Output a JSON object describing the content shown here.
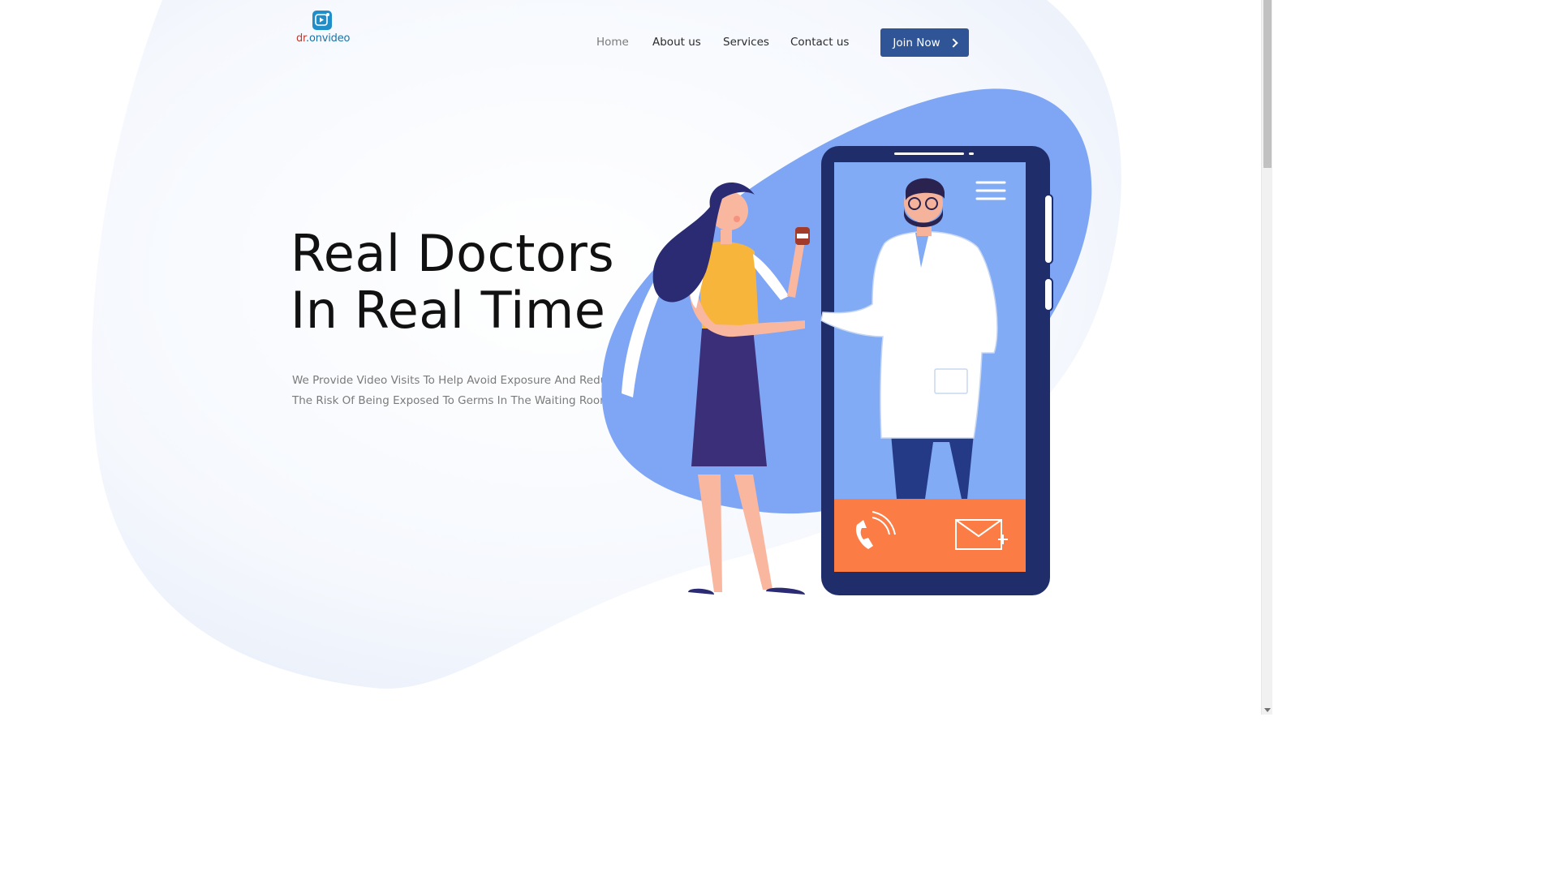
{
  "brand": {
    "logo_prefix": "dr",
    "logo_suffix": ".onvideo",
    "logo_icon": "play-video-icon"
  },
  "nav": {
    "items": [
      {
        "label": "Home",
        "active": true
      },
      {
        "label": "About us",
        "active": false
      },
      {
        "label": "Services",
        "active": false
      },
      {
        "label": "Contact us",
        "active": false
      }
    ],
    "cta_label": "Join Now"
  },
  "hero": {
    "title_line1": "Real Doctors",
    "title_line2": "In Real Time",
    "subtitle_line1": "We Provide Video Visits To Help Avoid Exposure And Reduce",
    "subtitle_line2": "The Risk Of Being Exposed To Germs In The Waiting Room."
  },
  "illustration": {
    "icons": [
      "phone-call-icon",
      "mail-icon",
      "menu-icon",
      "medicine-bottle-icon"
    ]
  },
  "colors": {
    "accent": "#2f5596",
    "blob_blue": "#7fa6f5",
    "phone_frame": "#1f2d6b",
    "screen_blue": "#82abf5",
    "call_bar": "#fb7d45",
    "skirt": "#3b2f7a",
    "shirt": "#f7b63b"
  }
}
